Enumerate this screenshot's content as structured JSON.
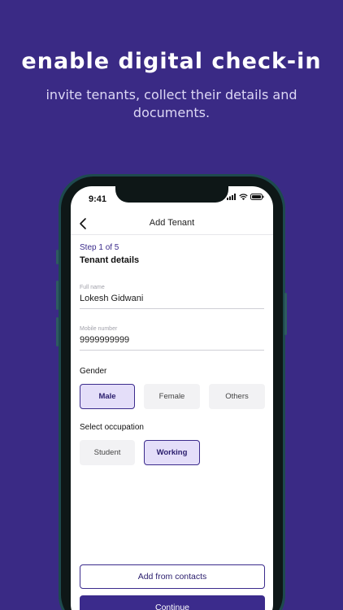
{
  "promo": {
    "headline": "enable digital check-in",
    "subline": "invite tenants, collect their details and documents."
  },
  "status_bar": {
    "time": "9:41"
  },
  "nav": {
    "title": "Add Tenant"
  },
  "form": {
    "step": "Step 1 of 5",
    "section_title": "Tenant details",
    "full_name": {
      "label": "Full name",
      "value": "Lokesh Gidwani"
    },
    "mobile": {
      "label": "Mobile number",
      "value": "9999999999"
    },
    "gender": {
      "label": "Gender",
      "options": [
        "Male",
        "Female",
        "Others"
      ],
      "selected": "Male"
    },
    "occupation": {
      "label": "Select occupation",
      "options": [
        "Student",
        "Working"
      ],
      "selected": "Working"
    }
  },
  "actions": {
    "add_from_contacts": "Add from contacts",
    "continue": "Continue"
  },
  "colors": {
    "background": "#3a2a85",
    "accent": "#3b2b8c",
    "selected_chip": "#e4def9"
  }
}
